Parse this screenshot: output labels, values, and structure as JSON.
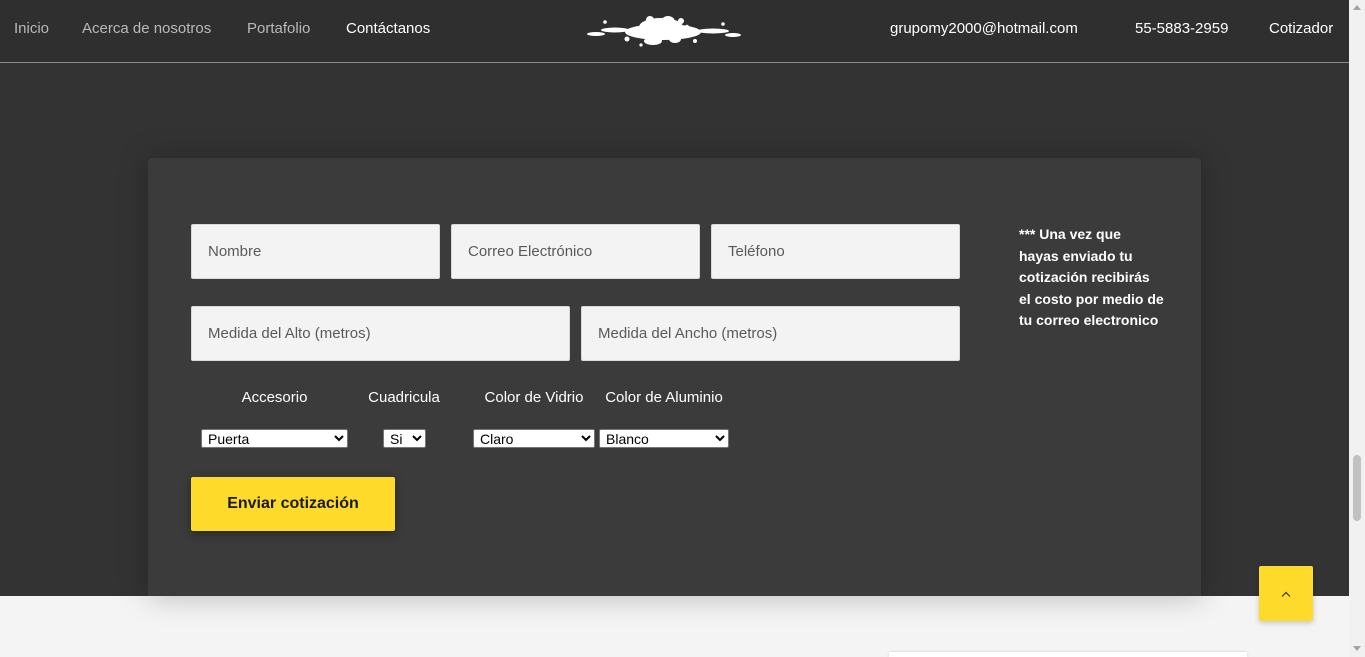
{
  "nav": {
    "items": [
      {
        "label": "Inicio"
      },
      {
        "label": "Acerca de nosotros"
      },
      {
        "label": "Portafolio"
      },
      {
        "label": "Contáctanos"
      }
    ],
    "email": "grupomy2000@hotmail.com",
    "phone": "55-5883-2959",
    "cotizador": "Cotizador"
  },
  "form": {
    "nombre_placeholder": "Nombre",
    "correo_placeholder": "Correo Electrónico",
    "telefono_placeholder": "Teléfono",
    "alto_placeholder": "Medida del Alto (metros)",
    "ancho_placeholder": "Medida del Ancho (metros)",
    "selects": [
      {
        "label": "Accesorio",
        "value": "Puerta"
      },
      {
        "label": "Cuadricula",
        "value": "Si"
      },
      {
        "label": "Color de Vidrio",
        "value": "Claro"
      },
      {
        "label": "Color de Aluminio",
        "value": "Blanco"
      }
    ],
    "submit_label": "Enviar cotización"
  },
  "note": "*** Una vez que hayas enviado tu cotización recibirás el costo por medio de tu correo electronico",
  "icons": {
    "logo": "splash-logo",
    "to_top": "chevron-up-icon"
  },
  "colors": {
    "accent": "#fedb2a",
    "nav_bg": "#2f2f2f",
    "hero_bg": "#333333",
    "card_bg": "#3b3b3b"
  }
}
